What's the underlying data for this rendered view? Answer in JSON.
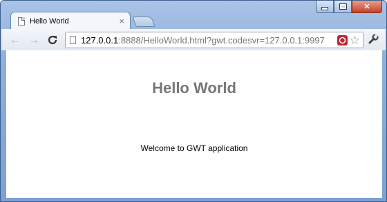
{
  "window": {
    "controls": {
      "minimize_icon": "minimize-icon",
      "maximize_icon": "maximize-icon",
      "close_icon": "close-icon",
      "close_glyph": "✕"
    }
  },
  "tabs": [
    {
      "title": "Hello World",
      "close_glyph": "×",
      "active": true
    }
  ],
  "toolbar": {
    "back_glyph": "←",
    "forward_glyph": "→",
    "reload_glyph": "C",
    "url_host": "127.0.0.1",
    "url_rest": ":8888/HelloWorld.html?gwt.codesvr=127.0.0.1:9997",
    "extension_badge": "GWT",
    "star_glyph": "☆",
    "wrench_glyph": "🔧"
  },
  "page": {
    "heading": "Hello World",
    "welcome_text": "Welcome to GWT application"
  },
  "colors": {
    "frame": "#7ba0d2",
    "heading": "#777777",
    "close_button": "#c7412a",
    "extension": "#c0272d"
  }
}
